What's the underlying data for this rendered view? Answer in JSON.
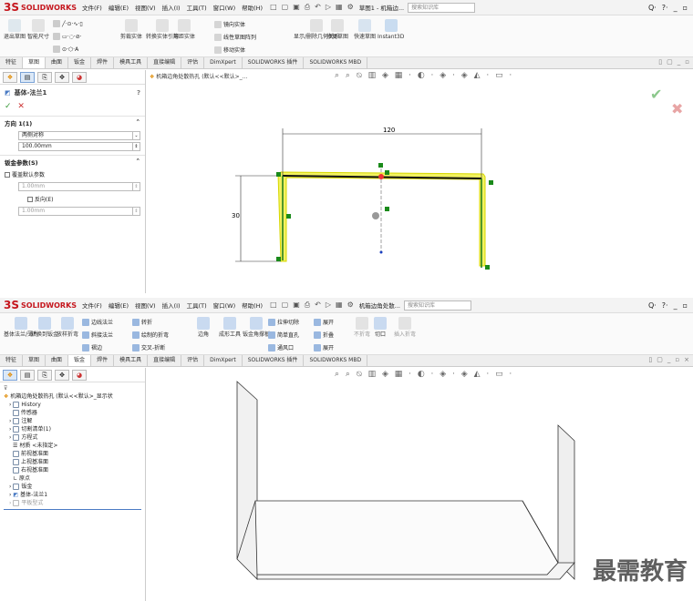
{
  "app": {
    "logo_text": "SOLIDWORKS",
    "logo_mark": "3S"
  },
  "menu": [
    "文件(F)",
    "编辑(E)",
    "视图(V)",
    "插入(I)",
    "工具(T)",
    "窗口(W)",
    "帮助(H)"
  ],
  "quick_access": [
    "□",
    "▢",
    "▣",
    "⎙",
    "↶",
    "▷",
    "▦",
    "⚙"
  ],
  "search_placeholder": "搜索知识库",
  "right_controls": [
    "Q·",
    "?·",
    "_",
    "▫"
  ],
  "tabs": [
    "特征",
    "草图",
    "曲面",
    "钣金",
    "焊件",
    "模具工具",
    "直接编辑",
    "评估",
    "DimXpert",
    "SOLIDWORKS 插件",
    "SOLIDWORKS MBD"
  ],
  "window_controls": [
    "▯",
    "▢",
    "_",
    "▫",
    "×"
  ],
  "hud_icons": "⌕ ⌕ ⦰ ▥ ◈ ▦ · ◐ · ◈ · ◈ ◭ · ▭ ·",
  "top": {
    "doc_title": "草图1 - 机箱边...",
    "ribbon": {
      "big_buttons": [
        "退出草图",
        "智能尺寸",
        "剪裁实体",
        "转换实体引用",
        "等距实体",
        "镜向实体",
        "线性草图阵列",
        "显示/删除几何关系",
        "修复草图",
        "快速草图",
        "Instant3D"
      ],
      "small": [
        "镜向实体",
        "线性草图阵列",
        "移动实体"
      ]
    },
    "tree_path": "机箱边角处散热孔 (默认<<默认>_...",
    "pm": {
      "title": "基体-法兰1",
      "direction_label": "方向 1(1)",
      "end_condition": "两侧对称",
      "depth": "100.00mm",
      "sheet_params_label": "钣金参数(S)",
      "override_default": "覆盖默认参数",
      "thickness": "1.00mm",
      "reverse": "反向(E)",
      "radius": "1.00mm",
      "help": "?",
      "ok": "✓",
      "cancel": "✕"
    },
    "dims": {
      "width": "120",
      "height": "30"
    }
  },
  "bottom": {
    "doc_title": "机箱边角处散...",
    "ribbon": {
      "big_buttons": [
        "基体法兰/薄片",
        "转换到钣金",
        "放样折弯",
        "边角",
        "成形工具",
        "钣金角撑板",
        "不折弯",
        "切口",
        "插入折弯"
      ],
      "small": [
        "边线法兰",
        "斜接法兰",
        "褶边",
        "转折",
        "绘制的折弯",
        "交叉-折断",
        "拉伸切除",
        "简单直孔",
        "通风口",
        "展开",
        "折叠",
        "展开"
      ]
    },
    "tree": {
      "root": "机箱边角处散热孔 (默认<<默认>_显示状",
      "items": [
        "History",
        "传感器",
        "注解",
        "切割清单(1)",
        "方程式",
        "材质 <未指定>",
        "前视基准面",
        "上视基准面",
        "右视基准面",
        "原点",
        "钣金",
        "基体-法兰1",
        "平板型式"
      ]
    }
  },
  "watermark": "最需教育"
}
